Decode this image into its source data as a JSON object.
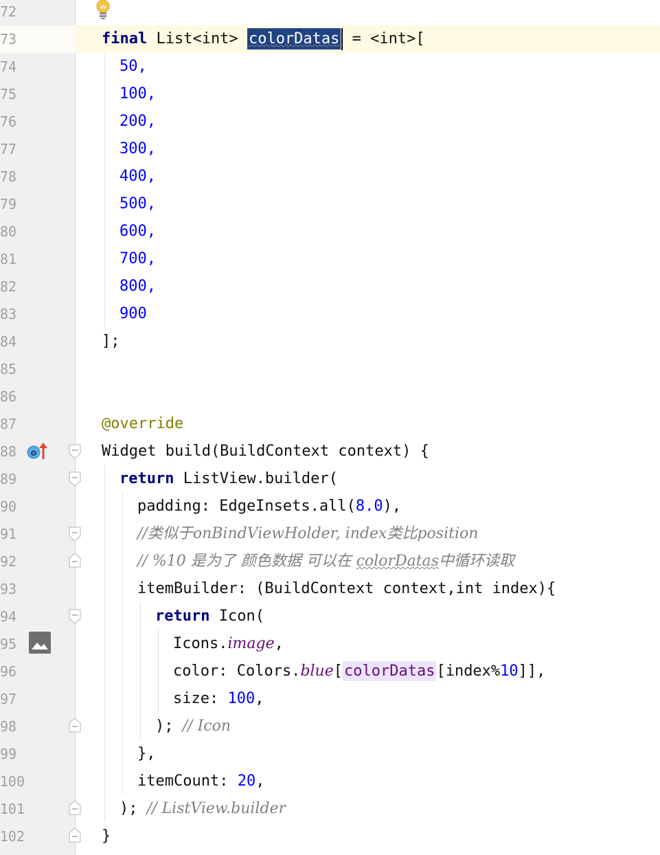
{
  "line_numbers": [
    "72",
    "73",
    "74",
    "75",
    "76",
    "77",
    "78",
    "79",
    "80",
    "81",
    "82",
    "83",
    "84",
    "85",
    "86",
    "87",
    "88",
    "89",
    "90",
    "91",
    "92",
    "93",
    "94",
    "95",
    "96",
    "97",
    "98",
    "99",
    "100",
    "101",
    "102"
  ],
  "code": {
    "l73": {
      "kw": "final",
      "type": "List<int>",
      "var": "colorDatas",
      "rest": " = <int>["
    },
    "values": [
      "50,",
      "100,",
      "200,",
      "300,",
      "400,",
      "500,",
      "600,",
      "700,",
      "800,",
      "900"
    ],
    "l84": "];",
    "l87": "@override",
    "l88": "Widget build(BuildContext context) {",
    "l89": {
      "kw": "return",
      "rest": " ListView.builder("
    },
    "l90": {
      "pre": "padding: EdgeInsets.all(",
      "num": "8.0",
      "post": "),"
    },
    "l91": "//类似于onBindViewHolder, index类比position",
    "l92": {
      "a": "// %10 是为了 颜色数据 可以在 ",
      "b": "colorDatas",
      "c": "中循环读取"
    },
    "l93": "itemBuilder: (BuildContext context,int index){",
    "l94": {
      "kw": "return",
      "rest": " Icon("
    },
    "l95": {
      "pre": "Icons.",
      "field": "image",
      "post": ","
    },
    "l96": {
      "pre": "color: Colors.",
      "field": "blue",
      "open": "[",
      "ref": "colorDatas",
      "mid": "[index%",
      "num": "10",
      "post": "]],"
    },
    "l97": {
      "pre": "size: ",
      "num": "100",
      "post": ","
    },
    "l98": {
      "code": "); ",
      "cmt": "// Icon"
    },
    "l99": "},",
    "l100": {
      "pre": "itemCount: ",
      "num": "20",
      "post": ","
    },
    "l101": {
      "code": "); ",
      "cmt": "// ListView.builder"
    },
    "l102": "}"
  },
  "icons": {
    "intention": "lightbulb-icon",
    "override": "override-method-icon",
    "gutter_image": "image-preview-icon"
  },
  "colors": {
    "keyword": "#000080",
    "number": "#0000ff",
    "annotation": "#808000",
    "comment": "#808080",
    "field": "#660e7a",
    "selection": "#214283",
    "current_line": "#fffae3"
  }
}
